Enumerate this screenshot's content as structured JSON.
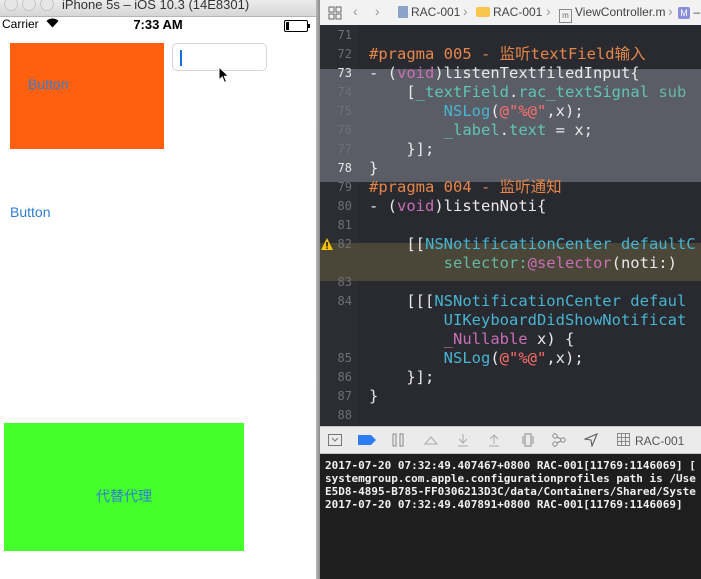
{
  "simulator": {
    "title": "iPhone 5s – iOS 10.3 (14E8301)",
    "status": {
      "carrier": "Carrier",
      "time": "7:33 AM"
    },
    "orange_button_label": "Button",
    "plain_button_label": "Button",
    "green_button_label": "代替代理",
    "colors": {
      "orange": "#ff6010",
      "green": "#44ff2a",
      "button_text": "#2f7fd2"
    }
  },
  "xcode": {
    "jumpbar": [
      "RAC-001",
      "RAC-001",
      "ViewController.m",
      "M",
      "–"
    ],
    "debug_scheme": "RAC-001",
    "code_lines": [
      {
        "num": "71",
        "tokens": []
      },
      {
        "num": "72",
        "tokens": [
          {
            "t": "#pragma 005 - 监听textField输入",
            "c": "t-pre"
          }
        ]
      },
      {
        "num": "73",
        "tokens": [
          {
            "t": "- (",
            "c": ""
          },
          {
            "t": "void",
            "c": "t-kw"
          },
          {
            "t": ")listenTextfiledInput{",
            "c": ""
          }
        ]
      },
      {
        "num": "74",
        "tokens": [
          {
            "t": "    [",
            "c": ""
          },
          {
            "t": "_textField",
            "c": "t-prop"
          },
          {
            "t": ".",
            "c": ""
          },
          {
            "t": "rac_textSignal",
            "c": "t-prop"
          },
          {
            "t": " sub",
            "c": "t-fn"
          }
        ]
      },
      {
        "num": "75",
        "tokens": [
          {
            "t": "        ",
            "c": ""
          },
          {
            "t": "NSLog",
            "c": "t-cls"
          },
          {
            "t": "(",
            "c": ""
          },
          {
            "t": "@\"%@\"",
            "c": "t-str"
          },
          {
            "t": ",x);",
            "c": ""
          }
        ]
      },
      {
        "num": "76",
        "tokens": [
          {
            "t": "        ",
            "c": ""
          },
          {
            "t": "_label",
            "c": "t-prop"
          },
          {
            "t": ".",
            "c": ""
          },
          {
            "t": "text",
            "c": "t-prop"
          },
          {
            "t": " = x;",
            "c": ""
          }
        ]
      },
      {
        "num": "77",
        "tokens": [
          {
            "t": "    }];",
            "c": ""
          }
        ]
      },
      {
        "num": "78",
        "tokens": [
          {
            "t": "}",
            "c": ""
          }
        ]
      },
      {
        "num": "79",
        "tokens": [
          {
            "t": "#pragma 004 - 监听通知",
            "c": "t-pre"
          }
        ]
      },
      {
        "num": "80",
        "tokens": [
          {
            "t": "- (",
            "c": ""
          },
          {
            "t": "void",
            "c": "t-kw"
          },
          {
            "t": ")listenNoti{",
            "c": ""
          }
        ]
      },
      {
        "num": "81",
        "tokens": []
      },
      {
        "num": "82",
        "tokens": [
          {
            "t": "    [[",
            "c": ""
          },
          {
            "t": "NSNotificationCenter",
            "c": "t-cls"
          },
          {
            "t": " defaultC",
            "c": "t-cls"
          }
        ]
      },
      {
        "num": "",
        "tokens": [
          {
            "t": "        selector:",
            "c": "t-fn"
          },
          {
            "t": "@selector",
            "c": "t-kw"
          },
          {
            "t": "(noti:)",
            "c": ""
          }
        ]
      },
      {
        "num": "83",
        "tokens": []
      },
      {
        "num": "84",
        "tokens": [
          {
            "t": "    [[[",
            "c": ""
          },
          {
            "t": "NSNotificationCenter",
            "c": "t-cls"
          },
          {
            "t": " defaul",
            "c": "t-cls"
          }
        ]
      },
      {
        "num": "",
        "tokens": [
          {
            "t": "        ",
            "c": ""
          },
          {
            "t": "UIKeyboardDidShowNotificat",
            "c": "t-cls"
          }
        ]
      },
      {
        "num": "",
        "tokens": [
          {
            "t": "        ",
            "c": ""
          },
          {
            "t": "_Nullable",
            "c": "t-kw"
          },
          {
            "t": " x) {",
            "c": ""
          }
        ]
      },
      {
        "num": "85",
        "tokens": [
          {
            "t": "        ",
            "c": ""
          },
          {
            "t": "NSLog",
            "c": "t-cls"
          },
          {
            "t": "(",
            "c": ""
          },
          {
            "t": "@\"%@\"",
            "c": "t-str"
          },
          {
            "t": ",x);",
            "c": ""
          }
        ]
      },
      {
        "num": "86",
        "tokens": [
          {
            "t": "    }];",
            "c": ""
          }
        ]
      },
      {
        "num": "87",
        "tokens": [
          {
            "t": "}",
            "c": ""
          }
        ]
      },
      {
        "num": "88",
        "tokens": []
      }
    ],
    "console_lines": [
      "2017-07-20 07:32:49.407467+0800 RAC-001[11769:1146069] [",
      "systemgroup.com.apple.configurationprofiles path is /Use",
      "E5D8-4895-B785-FF0306213D3C/data/Containers/Shared/Syste",
      "2017-07-20 07:32:49.407891+0800 RAC-001[11769:1146069] "
    ],
    "colors": {
      "editor_bg": "#292a30",
      "selection": "#5b5d66",
      "warning_line": "#4a4638"
    }
  }
}
